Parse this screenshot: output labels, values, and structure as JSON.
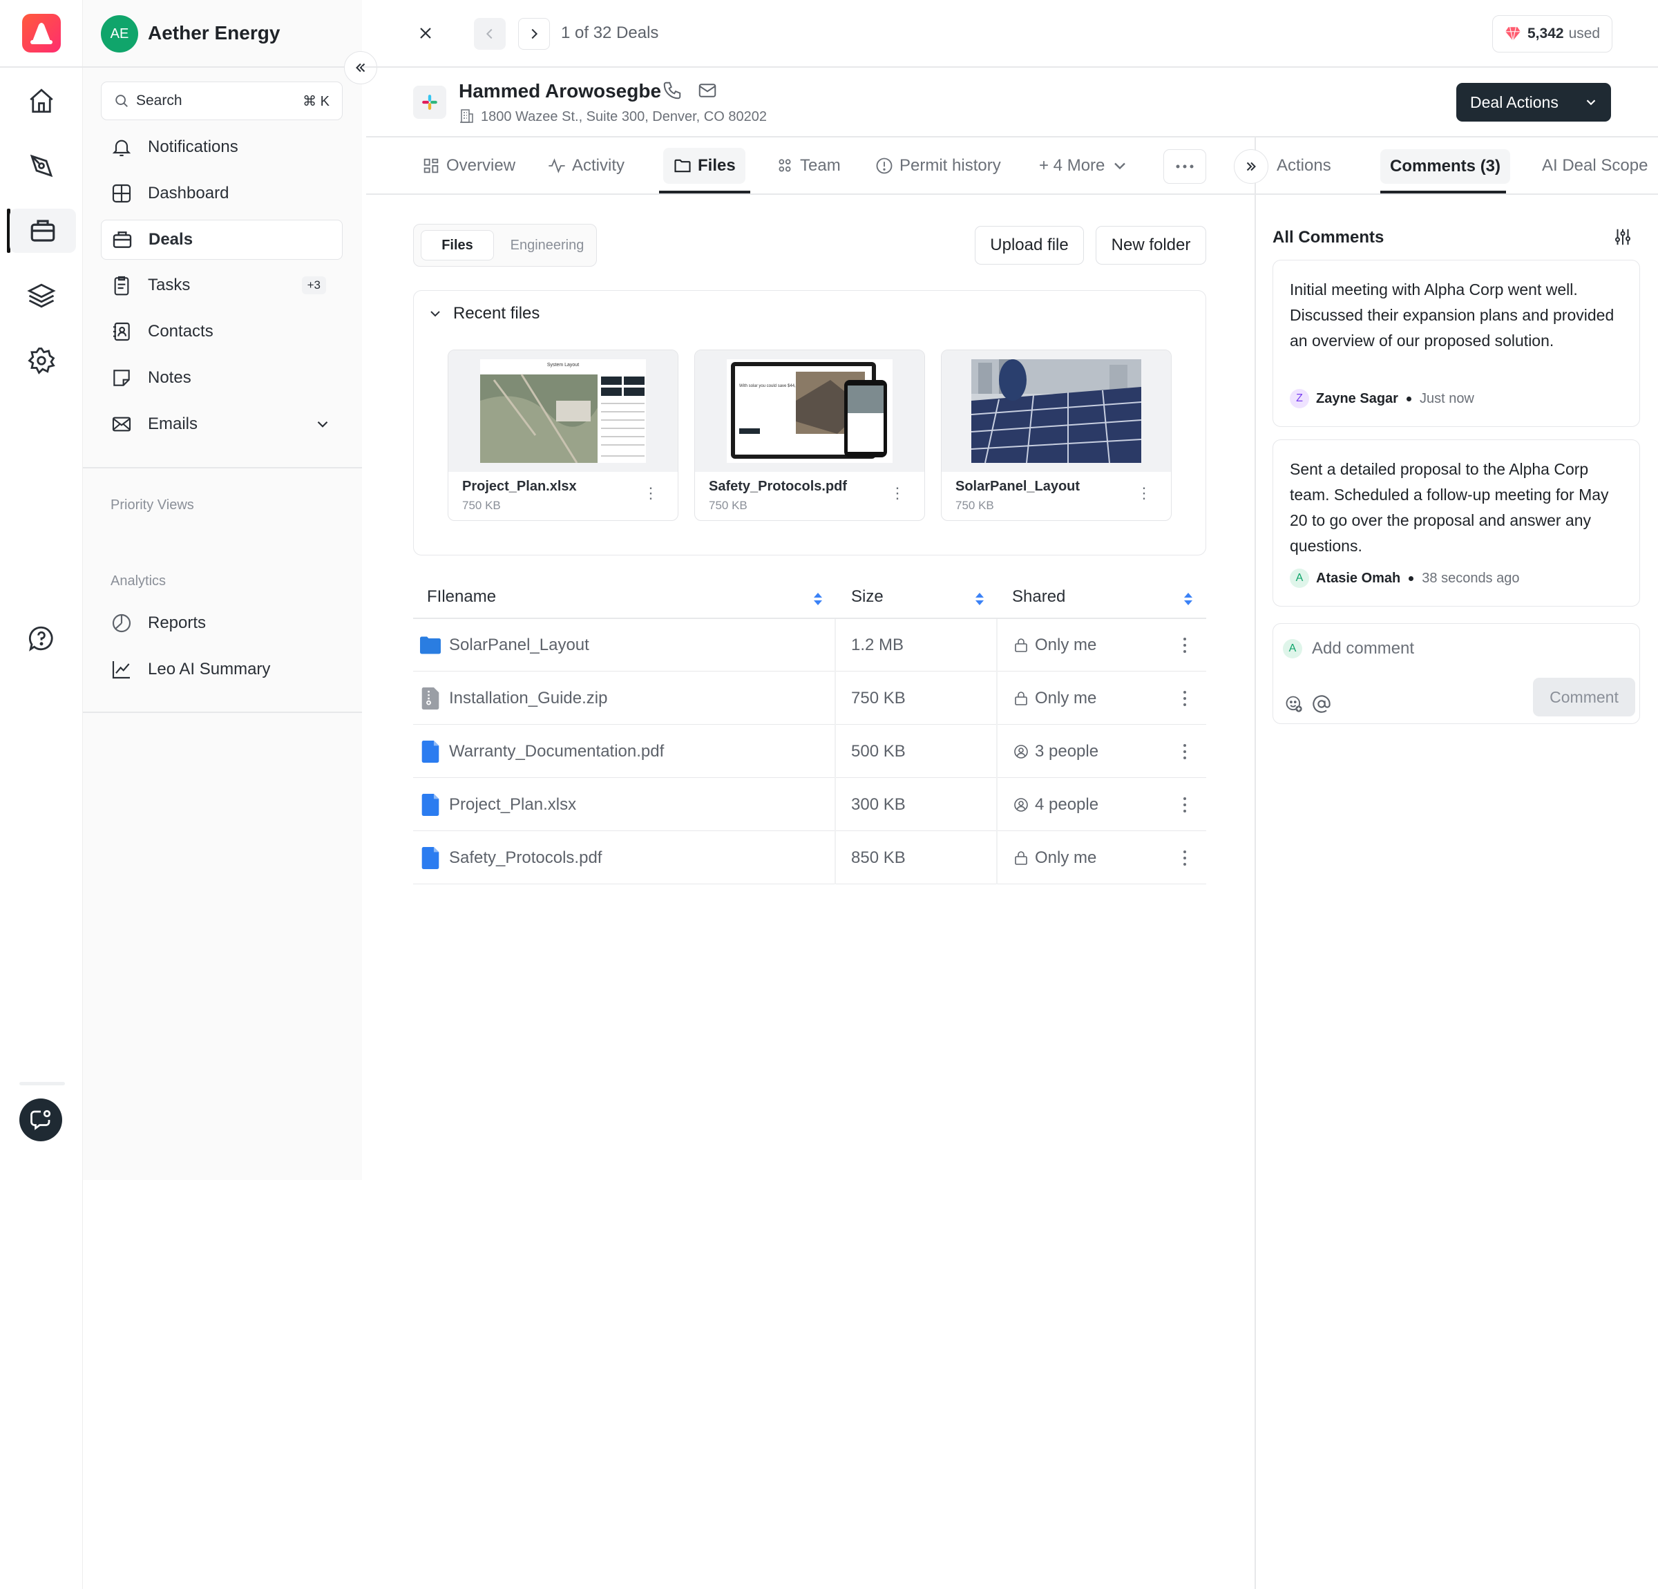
{
  "workspace": {
    "initials": "AE",
    "name": "Aether Energy"
  },
  "sidebar": {
    "search_placeholder": "Search",
    "search_shortcut": "⌘ K",
    "items": [
      {
        "label": "Notifications",
        "icon": "bell-icon"
      },
      {
        "label": "Dashboard",
        "icon": "grid-icon"
      },
      {
        "label": "Deals",
        "icon": "briefcase-icon"
      },
      {
        "label": "Tasks",
        "icon": "clipboard-icon",
        "badge": "+3"
      },
      {
        "label": "Contacts",
        "icon": "contact-book-icon"
      },
      {
        "label": "Notes",
        "icon": "note-icon"
      },
      {
        "label": "Emails",
        "icon": "mail-icon"
      }
    ],
    "priority_views_label": "Priority Views",
    "analytics_label": "Analytics",
    "analytics_items": [
      {
        "label": "Reports",
        "icon": "pie-chart-icon"
      },
      {
        "label": "Leo AI Summary",
        "icon": "trend-chart-icon"
      }
    ]
  },
  "topbar": {
    "pager": "1 of 32 Deals",
    "credits_value": "5,342",
    "credits_suffix": "used"
  },
  "deal": {
    "name": "Hammed Arowosegbe",
    "address": "1800 Wazee St., Suite 300, Denver, CO 80202",
    "actions_label": "Deal Actions"
  },
  "tabs": [
    "Overview",
    "Activity",
    "Files",
    "Team",
    "Permit history",
    "+ 4 More"
  ],
  "right_tabs": [
    "Actions",
    "Comments (3)",
    "AI Deal Scope"
  ],
  "files": {
    "subtabs": [
      "Files",
      "Engineering"
    ],
    "upload_label": "Upload file",
    "new_folder_label": "New folder",
    "recent_label": "Recent files",
    "recent": [
      {
        "name": "Project_Plan.xlsx",
        "size": "750 KB",
        "thumb_caption": "System Layout"
      },
      {
        "name": "Safety_Protocols.pdf",
        "size": "750 KB",
        "thumb_caption": "With solar you could save $44,400"
      },
      {
        "name": "SolarPanel_Layout",
        "size": "750 KB"
      }
    ],
    "columns": [
      "FIlename",
      "Size",
      "Shared"
    ],
    "rows": [
      {
        "name": "SolarPanel_Layout",
        "size": "1.2 MB",
        "shared": "Only me",
        "kind": "folder"
      },
      {
        "name": "Installation_Guide.zip",
        "size": "750 KB",
        "shared": "Only me",
        "kind": "zip"
      },
      {
        "name": "Warranty_Documentation.pdf",
        "size": "500 KB",
        "shared": "3 people",
        "kind": "doc"
      },
      {
        "name": "Project_Plan.xlsx",
        "size": "300 KB",
        "shared": "4 people",
        "kind": "doc"
      },
      {
        "name": "Safety_Protocols.pdf",
        "size": "850 KB",
        "shared": "Only me",
        "kind": "doc"
      }
    ]
  },
  "comments": {
    "header": "All Comments",
    "items": [
      {
        "text": "Initial meeting with Alpha Corp went well. Discussed their expansion plans and provided an overview of our proposed solution.",
        "author": "Zayne Sagar",
        "initial": "Z",
        "time": "Just now"
      },
      {
        "text": "Sent a detailed proposal to the Alpha Corp team. Scheduled a follow-up meeting for May 20 to go over the proposal and answer any questions.",
        "author": "Atasie Omah",
        "initial": "A",
        "time": "38 seconds ago"
      }
    ],
    "composer_initial": "A",
    "placeholder": "Add comment",
    "submit_label": "Comment"
  },
  "colors": {
    "brand_logo": "#ff3b4a",
    "primary_dark": "#1f2a33",
    "folder_blue": "#2a7de1",
    "doc_blue": "#2b7cf0",
    "workspace_green": "#10a56b"
  }
}
